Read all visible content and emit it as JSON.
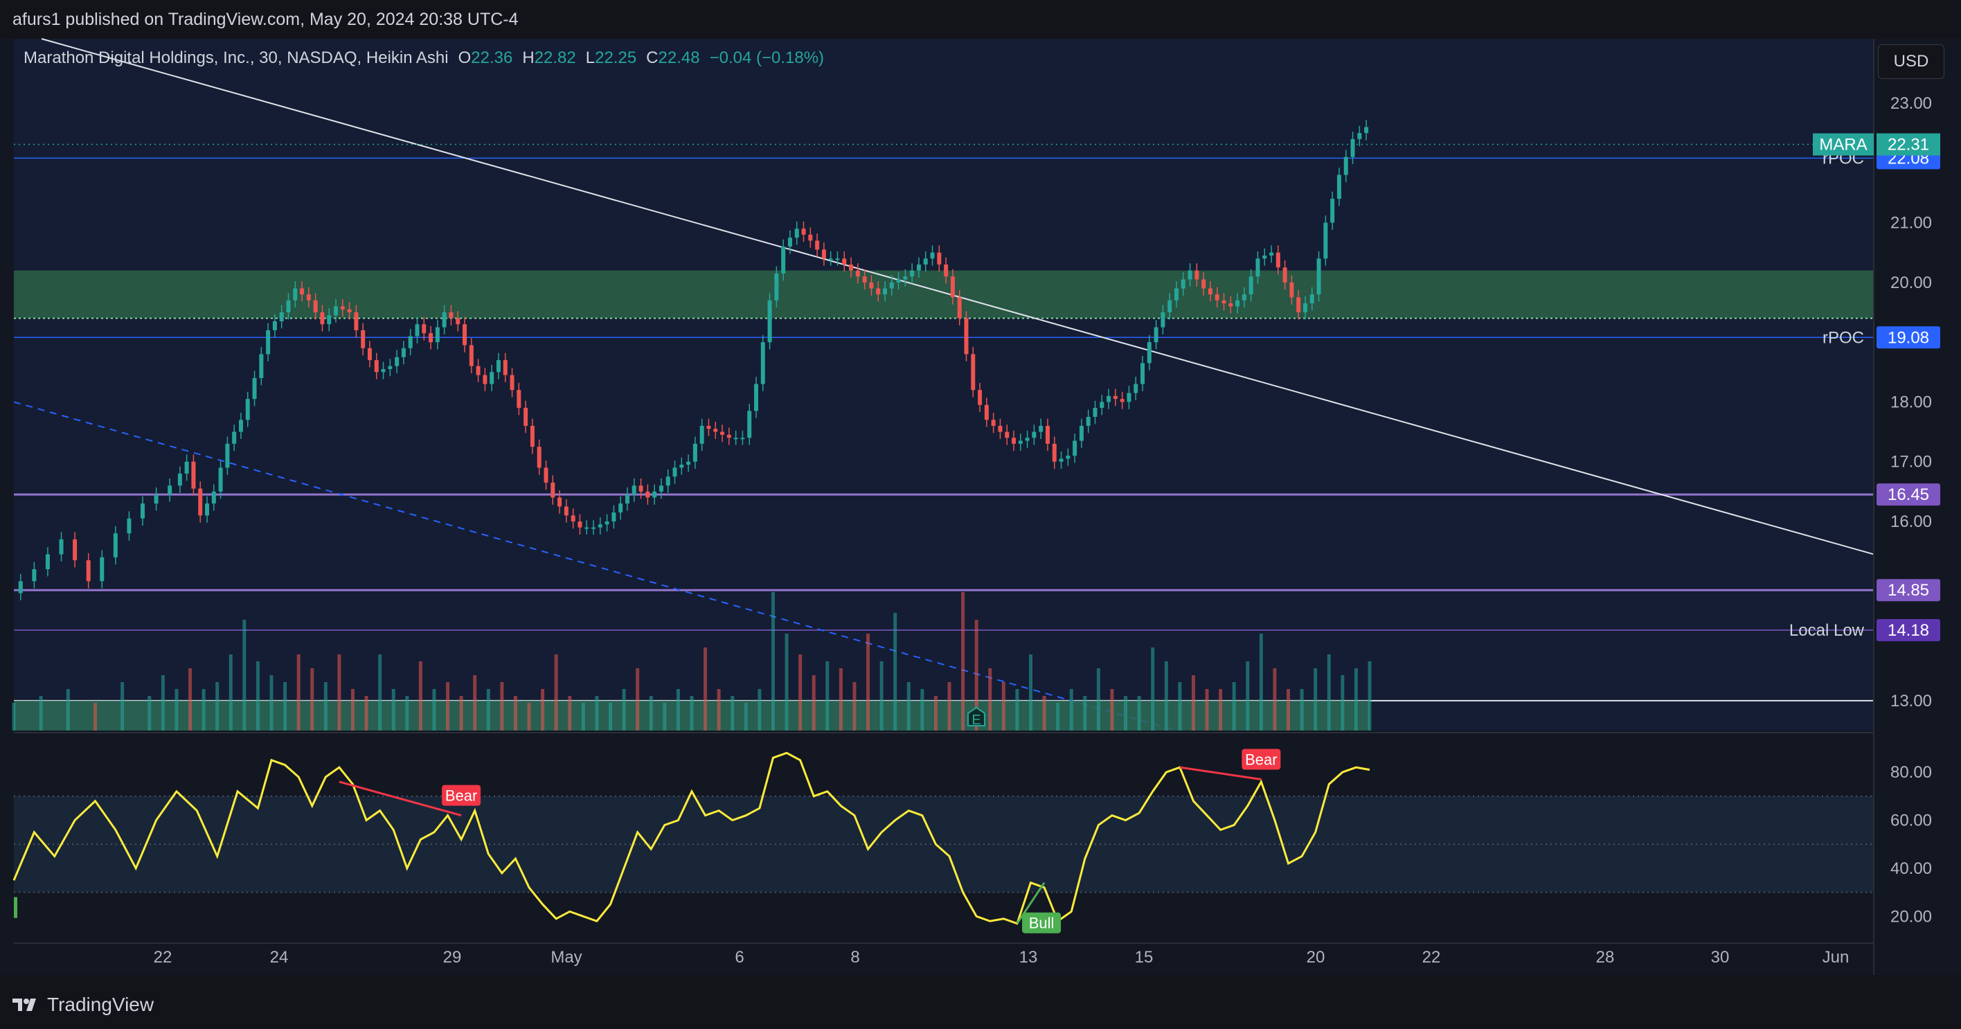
{
  "header": {
    "published": "afurs1 published on TradingView.com, May 20, 2024 20:38 UTC-4"
  },
  "legend": {
    "symbol": "Marathon Digital Holdings, Inc., 30, NASDAQ, Heikin Ashi",
    "o_label": "O",
    "o_value": "22.36",
    "h_label": "H",
    "h_value": "22.82",
    "l_label": "L",
    "l_value": "22.25",
    "c_label": "C",
    "c_value": "22.48",
    "change": "−0.04 (−0.18%)"
  },
  "currency": "USD",
  "footer": {
    "brand": "TradingView"
  },
  "colors": {
    "background": "#131722",
    "up": "#26a69a",
    "down": "#ef5350",
    "zone": "#2f6b4b",
    "rpoc": "#2962ff",
    "purple": "#9575cd",
    "rsi": "#ffeb3b",
    "bear": "#f23645",
    "bull": "#4caf50"
  },
  "chart_data": [
    {
      "type": "candlestick",
      "symbol_label": "MARA",
      "last_price": "22.31",
      "y_ticks": [
        "23.00",
        "21.00",
        "20.00",
        "18.00",
        "17.00",
        "16.00",
        "13.00"
      ],
      "ylim": [
        12.5,
        23.8
      ],
      "x_ticks": [
        "22",
        "24",
        "29",
        "May",
        "6",
        "8",
        "13",
        "15",
        "20",
        "22",
        "28",
        "30",
        "Jun"
      ],
      "levels": [
        {
          "name": "rPOC",
          "value": 22.08,
          "label": "rPOC",
          "tag": "22.08"
        },
        {
          "name": "rPOC",
          "value": 19.08,
          "label": "rPOC",
          "tag": "19.08"
        },
        {
          "name": "support",
          "value": 16.45,
          "label": "",
          "tag": "16.45"
        },
        {
          "name": "support",
          "value": 14.85,
          "label": "",
          "tag": "14.85"
        },
        {
          "name": "local-low",
          "value": 14.18,
          "label": "Local Low",
          "tag": "14.18"
        },
        {
          "name": "baseline",
          "value": 13.0,
          "label": "",
          "tag": ""
        }
      ],
      "zone": [
        19.4,
        20.2
      ],
      "close_path": [
        [
          0,
          14.8
        ],
        [
          4,
          15.2
        ],
        [
          8,
          15.7
        ],
        [
          12,
          15.0
        ],
        [
          16,
          15.8
        ],
        [
          20,
          16.3
        ],
        [
          24,
          16.6
        ],
        [
          26,
          17.0
        ],
        [
          28,
          16.1
        ],
        [
          30,
          16.5
        ],
        [
          32,
          17.3
        ],
        [
          34,
          17.7
        ],
        [
          36,
          18.4
        ],
        [
          38,
          19.2
        ],
        [
          40,
          19.5
        ],
        [
          42,
          19.9
        ],
        [
          44,
          19.7
        ],
        [
          46,
          19.3
        ],
        [
          48,
          19.6
        ],
        [
          50,
          19.5
        ],
        [
          52,
          18.9
        ],
        [
          54,
          18.5
        ],
        [
          56,
          18.6
        ],
        [
          58,
          18.9
        ],
        [
          60,
          19.3
        ],
        [
          62,
          19.0
        ],
        [
          64,
          19.5
        ],
        [
          66,
          19.3
        ],
        [
          68,
          18.6
        ],
        [
          70,
          18.3
        ],
        [
          72,
          18.7
        ],
        [
          74,
          18.2
        ],
        [
          76,
          17.6
        ],
        [
          78,
          16.9
        ],
        [
          80,
          16.4
        ],
        [
          82,
          16.1
        ],
        [
          84,
          15.9
        ],
        [
          86,
          15.9
        ],
        [
          88,
          16.0
        ],
        [
          90,
          16.3
        ],
        [
          92,
          16.6
        ],
        [
          94,
          16.4
        ],
        [
          96,
          16.6
        ],
        [
          98,
          16.9
        ],
        [
          100,
          17.0
        ],
        [
          102,
          17.6
        ],
        [
          104,
          17.5
        ],
        [
          106,
          17.4
        ],
        [
          108,
          17.4
        ],
        [
          110,
          18.3
        ],
        [
          112,
          19.7
        ],
        [
          114,
          20.6
        ],
        [
          116,
          20.9
        ],
        [
          118,
          20.7
        ],
        [
          120,
          20.4
        ],
        [
          122,
          20.4
        ],
        [
          124,
          20.2
        ],
        [
          126,
          20.0
        ],
        [
          128,
          19.8
        ],
        [
          130,
          20.0
        ],
        [
          132,
          20.1
        ],
        [
          134,
          20.3
        ],
        [
          136,
          20.5
        ],
        [
          138,
          20.1
        ],
        [
          140,
          19.4
        ],
        [
          142,
          18.2
        ],
        [
          144,
          17.7
        ],
        [
          146,
          17.5
        ],
        [
          148,
          17.3
        ],
        [
          150,
          17.4
        ],
        [
          152,
          17.6
        ],
        [
          154,
          17.0
        ],
        [
          156,
          17.1
        ],
        [
          158,
          17.6
        ],
        [
          160,
          17.9
        ],
        [
          162,
          18.1
        ],
        [
          164,
          18.0
        ],
        [
          166,
          18.3
        ],
        [
          168,
          19.0
        ],
        [
          170,
          19.5
        ],
        [
          172,
          19.9
        ],
        [
          174,
          20.2
        ],
        [
          176,
          19.9
        ],
        [
          178,
          19.7
        ],
        [
          180,
          19.6
        ],
        [
          182,
          19.8
        ],
        [
          184,
          20.4
        ],
        [
          186,
          20.5
        ],
        [
          188,
          20.0
        ],
        [
          190,
          19.5
        ],
        [
          192,
          19.8
        ],
        [
          194,
          21.0
        ],
        [
          196,
          21.8
        ],
        [
          198,
          22.4
        ],
        [
          200,
          22.6
        ]
      ],
      "volume": [
        [
          0,
          0.2
        ],
        [
          4,
          0.25
        ],
        [
          8,
          0.3
        ],
        [
          12,
          0.2
        ],
        [
          16,
          0.35
        ],
        [
          20,
          0.25
        ],
        [
          22,
          0.4
        ],
        [
          24,
          0.3
        ],
        [
          26,
          0.45
        ],
        [
          28,
          0.3
        ],
        [
          30,
          0.35
        ],
        [
          32,
          0.55
        ],
        [
          34,
          0.8
        ],
        [
          36,
          0.5
        ],
        [
          38,
          0.4
        ],
        [
          40,
          0.35
        ],
        [
          42,
          0.55
        ],
        [
          44,
          0.45
        ],
        [
          46,
          0.35
        ],
        [
          48,
          0.55
        ],
        [
          50,
          0.3
        ],
        [
          52,
          0.25
        ],
        [
          54,
          0.55
        ],
        [
          56,
          0.3
        ],
        [
          58,
          0.25
        ],
        [
          60,
          0.5
        ],
        [
          62,
          0.3
        ],
        [
          64,
          0.35
        ],
        [
          66,
          0.25
        ],
        [
          68,
          0.4
        ],
        [
          70,
          0.3
        ],
        [
          72,
          0.35
        ],
        [
          74,
          0.25
        ],
        [
          76,
          0.2
        ],
        [
          78,
          0.3
        ],
        [
          80,
          0.55
        ],
        [
          82,
          0.25
        ],
        [
          84,
          0.2
        ],
        [
          86,
          0.25
        ],
        [
          88,
          0.2
        ],
        [
          90,
          0.3
        ],
        [
          92,
          0.45
        ],
        [
          94,
          0.25
        ],
        [
          96,
          0.2
        ],
        [
          98,
          0.3
        ],
        [
          100,
          0.25
        ],
        [
          102,
          0.6
        ],
        [
          104,
          0.3
        ],
        [
          106,
          0.25
        ],
        [
          108,
          0.2
        ],
        [
          110,
          0.3
        ],
        [
          112,
          1.0
        ],
        [
          114,
          0.7
        ],
        [
          116,
          0.55
        ],
        [
          118,
          0.4
        ],
        [
          120,
          0.5
        ],
        [
          122,
          0.45
        ],
        [
          124,
          0.35
        ],
        [
          126,
          0.7
        ],
        [
          128,
          0.5
        ],
        [
          130,
          0.85
        ],
        [
          132,
          0.35
        ],
        [
          134,
          0.3
        ],
        [
          136,
          0.25
        ],
        [
          138,
          0.35
        ],
        [
          140,
          1.0
        ],
        [
          142,
          0.8
        ],
        [
          144,
          0.45
        ],
        [
          146,
          0.35
        ],
        [
          148,
          0.3
        ],
        [
          150,
          0.55
        ],
        [
          152,
          0.25
        ],
        [
          154,
          0.2
        ],
        [
          156,
          0.3
        ],
        [
          158,
          0.25
        ],
        [
          160,
          0.45
        ],
        [
          162,
          0.3
        ],
        [
          164,
          0.25
        ],
        [
          166,
          0.25
        ],
        [
          168,
          0.6
        ],
        [
          170,
          0.5
        ],
        [
          172,
          0.35
        ],
        [
          174,
          0.4
        ],
        [
          176,
          0.3
        ],
        [
          178,
          0.3
        ],
        [
          180,
          0.35
        ],
        [
          182,
          0.5
        ],
        [
          184,
          0.7
        ],
        [
          186,
          0.45
        ],
        [
          188,
          0.3
        ],
        [
          190,
          0.3
        ],
        [
          192,
          0.45
        ],
        [
          194,
          0.55
        ],
        [
          196,
          0.4
        ],
        [
          198,
          0.45
        ],
        [
          200,
          0.5
        ]
      ]
    },
    {
      "type": "line",
      "name": "RSI",
      "y_ticks": [
        "80.00",
        "60.00",
        "40.00",
        "20.00"
      ],
      "ylim": [
        10,
        93
      ],
      "bands": [
        70,
        50,
        30
      ],
      "values": [
        [
          0,
          35
        ],
        [
          3,
          55
        ],
        [
          6,
          45
        ],
        [
          9,
          60
        ],
        [
          12,
          68
        ],
        [
          15,
          56
        ],
        [
          18,
          40
        ],
        [
          21,
          60
        ],
        [
          24,
          72
        ],
        [
          27,
          64
        ],
        [
          30,
          45
        ],
        [
          33,
          72
        ],
        [
          36,
          65
        ],
        [
          38,
          85
        ],
        [
          40,
          83
        ],
        [
          42,
          78
        ],
        [
          44,
          66
        ],
        [
          46,
          78
        ],
        [
          48,
          82
        ],
        [
          50,
          75
        ],
        [
          52,
          60
        ],
        [
          54,
          64
        ],
        [
          56,
          56
        ],
        [
          58,
          40
        ],
        [
          60,
          52
        ],
        [
          62,
          55
        ],
        [
          64,
          62
        ],
        [
          66,
          52
        ],
        [
          68,
          64
        ],
        [
          70,
          46
        ],
        [
          72,
          38
        ],
        [
          74,
          44
        ],
        [
          76,
          32
        ],
        [
          78,
          25
        ],
        [
          80,
          19
        ],
        [
          82,
          22
        ],
        [
          84,
          20
        ],
        [
          86,
          18
        ],
        [
          88,
          25
        ],
        [
          90,
          40
        ],
        [
          92,
          55
        ],
        [
          94,
          48
        ],
        [
          96,
          58
        ],
        [
          98,
          60
        ],
        [
          100,
          72
        ],
        [
          102,
          62
        ],
        [
          104,
          64
        ],
        [
          106,
          60
        ],
        [
          108,
          62
        ],
        [
          110,
          65
        ],
        [
          112,
          86
        ],
        [
          114,
          88
        ],
        [
          116,
          85
        ],
        [
          118,
          70
        ],
        [
          120,
          72
        ],
        [
          122,
          66
        ],
        [
          124,
          62
        ],
        [
          126,
          48
        ],
        [
          128,
          55
        ],
        [
          130,
          60
        ],
        [
          132,
          64
        ],
        [
          134,
          62
        ],
        [
          136,
          50
        ],
        [
          138,
          45
        ],
        [
          140,
          30
        ],
        [
          142,
          20
        ],
        [
          144,
          18
        ],
        [
          146,
          19
        ],
        [
          148,
          17
        ],
        [
          150,
          34
        ],
        [
          152,
          32
        ],
        [
          154,
          18
        ],
        [
          156,
          22
        ],
        [
          158,
          44
        ],
        [
          160,
          58
        ],
        [
          162,
          62
        ],
        [
          164,
          60
        ],
        [
          166,
          63
        ],
        [
          168,
          72
        ],
        [
          170,
          80
        ],
        [
          172,
          82
        ],
        [
          174,
          68
        ],
        [
          176,
          62
        ],
        [
          178,
          56
        ],
        [
          180,
          58
        ],
        [
          182,
          66
        ],
        [
          184,
          76
        ],
        [
          186,
          60
        ],
        [
          188,
          42
        ],
        [
          190,
          45
        ],
        [
          192,
          55
        ],
        [
          194,
          75
        ],
        [
          196,
          80
        ],
        [
          198,
          82
        ],
        [
          200,
          81
        ]
      ],
      "divergences": [
        {
          "label": "Bear",
          "from": [
            48,
            76
          ],
          "to": [
            66,
            62
          ]
        },
        {
          "label": "Bull",
          "from": [
            148,
            17
          ],
          "to": [
            152,
            34
          ]
        },
        {
          "label": "Bear",
          "from": [
            172,
            82
          ],
          "to": [
            184,
            77
          ]
        }
      ]
    }
  ]
}
